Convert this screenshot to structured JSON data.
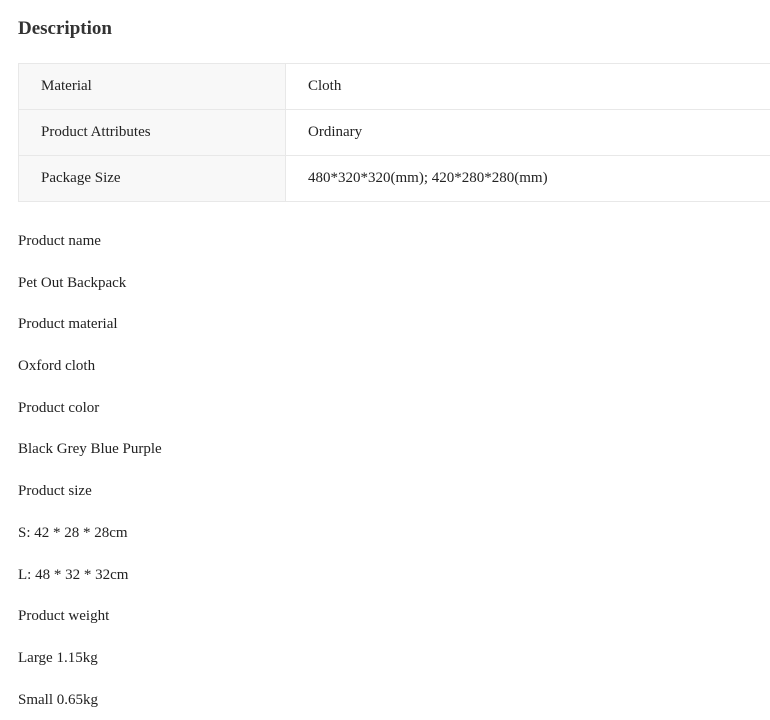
{
  "section_title": "Description",
  "attributes": [
    {
      "key": "Material",
      "value": "Cloth"
    },
    {
      "key": "Product Attributes",
      "value": "Ordinary"
    },
    {
      "key": "Package Size",
      "value": "480*320*320(mm); 420*280*280(mm)"
    }
  ],
  "details": [
    "Product name",
    "Pet Out Backpack",
    "Product material",
    "Oxford cloth",
    "Product color",
    "Black Grey Blue Purple",
    "Product size",
    "S: 42 * 28 * 28cm",
    "L: 48 * 32 * 32cm",
    "Product weight",
    "Large 1.15kg",
    "Small 0.65kg"
  ]
}
